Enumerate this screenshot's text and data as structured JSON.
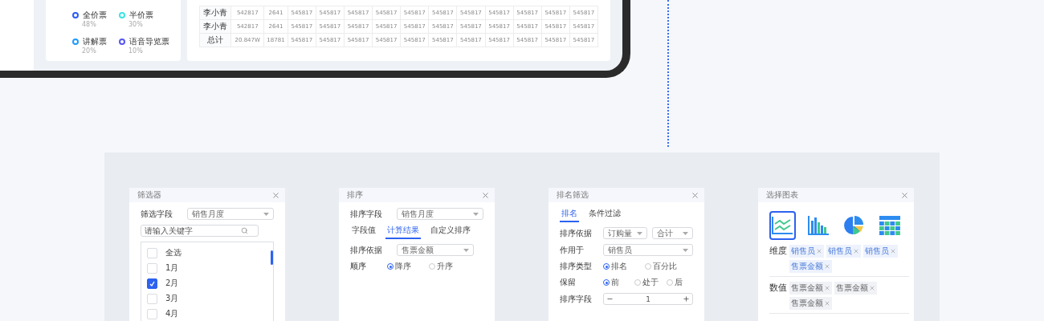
{
  "legend": [
    {
      "label": "全价票",
      "percent": "48%",
      "color": "#2a5cf5"
    },
    {
      "label": "半价票",
      "percent": "30%",
      "color": "#3ee3e3"
    },
    {
      "label": "讲解票",
      "percent": "20%",
      "color": "#1f9bff"
    },
    {
      "label": "语音导览票",
      "percent": "10%",
      "color": "#5656f0"
    }
  ],
  "table": {
    "rows": [
      [
        "李小青",
        "542817",
        "2641",
        "545817",
        "545817",
        "545817",
        "545817",
        "545817",
        "545817",
        "545817",
        "545817",
        "545817",
        "545817",
        "545817"
      ],
      [
        "李小青",
        "542817",
        "2641",
        "545817",
        "545817",
        "545817",
        "545817",
        "545817",
        "545817",
        "545817",
        "545817",
        "545817",
        "545817",
        "545817"
      ],
      [
        "总计",
        "20.847W",
        "18781",
        "545817",
        "545817",
        "545817",
        "545817",
        "545817",
        "545817",
        "545817",
        "545817",
        "545817",
        "545817",
        "545817"
      ]
    ]
  },
  "filter_dialog": {
    "title": "筛选器",
    "field_label": "筛选字段",
    "field_value": "销售月度",
    "search_placeholder": "请输入关键字",
    "options": [
      {
        "label": "全选",
        "checked": false
      },
      {
        "label": "1月",
        "checked": false
      },
      {
        "label": "2月",
        "checked": true
      },
      {
        "label": "3月",
        "checked": false
      },
      {
        "label": "4月",
        "checked": false
      }
    ]
  },
  "sort_dialog": {
    "title": "排序",
    "field_label": "排序字段",
    "field_value": "销售月度",
    "tabs": [
      {
        "label": "字段值",
        "selected": false
      },
      {
        "label": "计算结果",
        "selected": true
      },
      {
        "label": "自定义排序",
        "selected": false
      }
    ],
    "basis_label": "排序依据",
    "basis_value": "售票金额",
    "order_label": "顺序",
    "order_options": [
      {
        "label": "降序",
        "selected": true
      },
      {
        "label": "升序",
        "selected": false
      }
    ]
  },
  "rank_dialog": {
    "title": "排名筛选",
    "tabs": [
      {
        "label": "排名",
        "selected": true
      },
      {
        "label": "条件过滤",
        "selected": false
      }
    ],
    "basis_label": "排序依据",
    "basis_values": [
      "订购量",
      "合计"
    ],
    "apply_label": "作用于",
    "apply_value": "销售员",
    "type_label": "排序类型",
    "type_options": [
      {
        "label": "排名",
        "selected": true
      },
      {
        "label": "百分比",
        "selected": false
      }
    ],
    "keep_label": "保留",
    "keep_options": [
      {
        "label": "前",
        "selected": true
      },
      {
        "label": "处于",
        "selected": false
      },
      {
        "label": "后",
        "selected": false
      }
    ],
    "field_label": "排序字段",
    "field_value": "1"
  },
  "chart_dialog": {
    "title": "选择图表",
    "chart_types": [
      {
        "kind": "line",
        "selected": true
      },
      {
        "kind": "bar",
        "selected": false
      },
      {
        "kind": "pie",
        "selected": false
      },
      {
        "kind": "table",
        "selected": false
      }
    ],
    "groups": [
      {
        "label": "维度",
        "kind": "dimension",
        "tags": [
          "销售员",
          "销售员",
          "销售员",
          "售票金额"
        ]
      },
      {
        "label": "数值",
        "kind": "value",
        "tags": [
          "售票金额",
          "售票金额",
          "售票金额"
        ]
      }
    ]
  }
}
